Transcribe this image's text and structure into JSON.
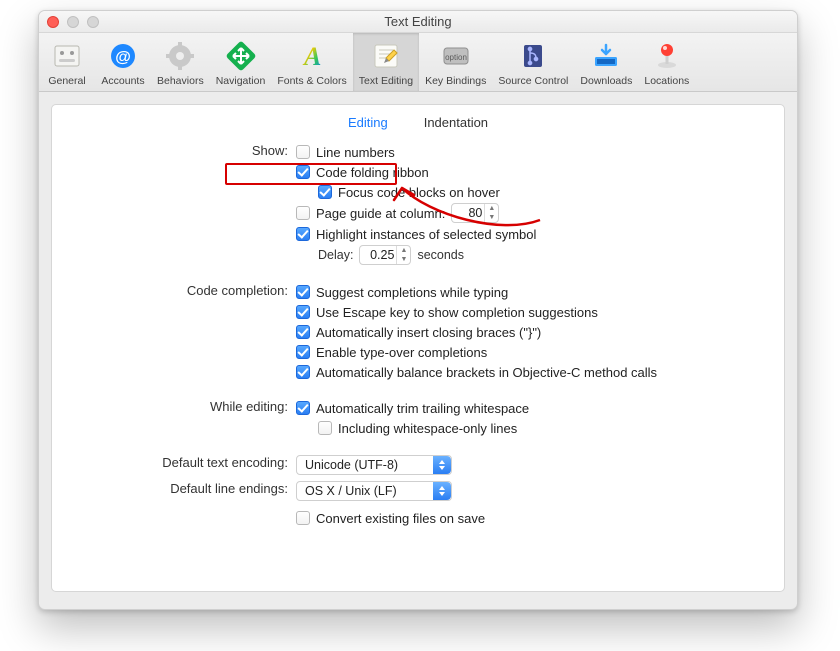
{
  "window": {
    "title": "Text Editing"
  },
  "toolbar": {
    "items": [
      {
        "label": "General"
      },
      {
        "label": "Accounts"
      },
      {
        "label": "Behaviors"
      },
      {
        "label": "Navigation"
      },
      {
        "label": "Fonts & Colors"
      },
      {
        "label": "Text Editing"
      },
      {
        "label": "Key Bindings"
      },
      {
        "label": "Source Control"
      },
      {
        "label": "Downloads"
      },
      {
        "label": "Locations"
      }
    ]
  },
  "subtabs": {
    "editing": "Editing",
    "indentation": "Indentation"
  },
  "labels": {
    "show": "Show:",
    "delay": "Delay:",
    "seconds": "seconds",
    "completion": "Code completion:",
    "while_editing": "While editing:",
    "encoding": "Default text encoding:",
    "endings": "Default line endings:"
  },
  "show": {
    "line_numbers": "Line numbers",
    "code_folding": "Code folding ribbon",
    "focus_hover": "Focus code blocks on hover",
    "page_guide_prefix": "Page guide at column:",
    "page_guide_value": "80",
    "highlight": "Highlight instances of selected symbol",
    "delay_value": "0.25"
  },
  "completion": {
    "suggest": "Suggest completions while typing",
    "escape": "Use Escape key to show completion suggestions",
    "closing": "Automatically insert closing braces (\"}\")",
    "typeover": "Enable type-over completions",
    "balance": "Automatically balance brackets in Objective-C method calls"
  },
  "while_editing": {
    "trim": "Automatically trim trailing whitespace",
    "ws_only": "Including whitespace-only lines"
  },
  "dropdowns": {
    "encoding": "Unicode (UTF-8)",
    "endings": "OS X / Unix (LF)",
    "convert": "Convert existing files on save"
  }
}
